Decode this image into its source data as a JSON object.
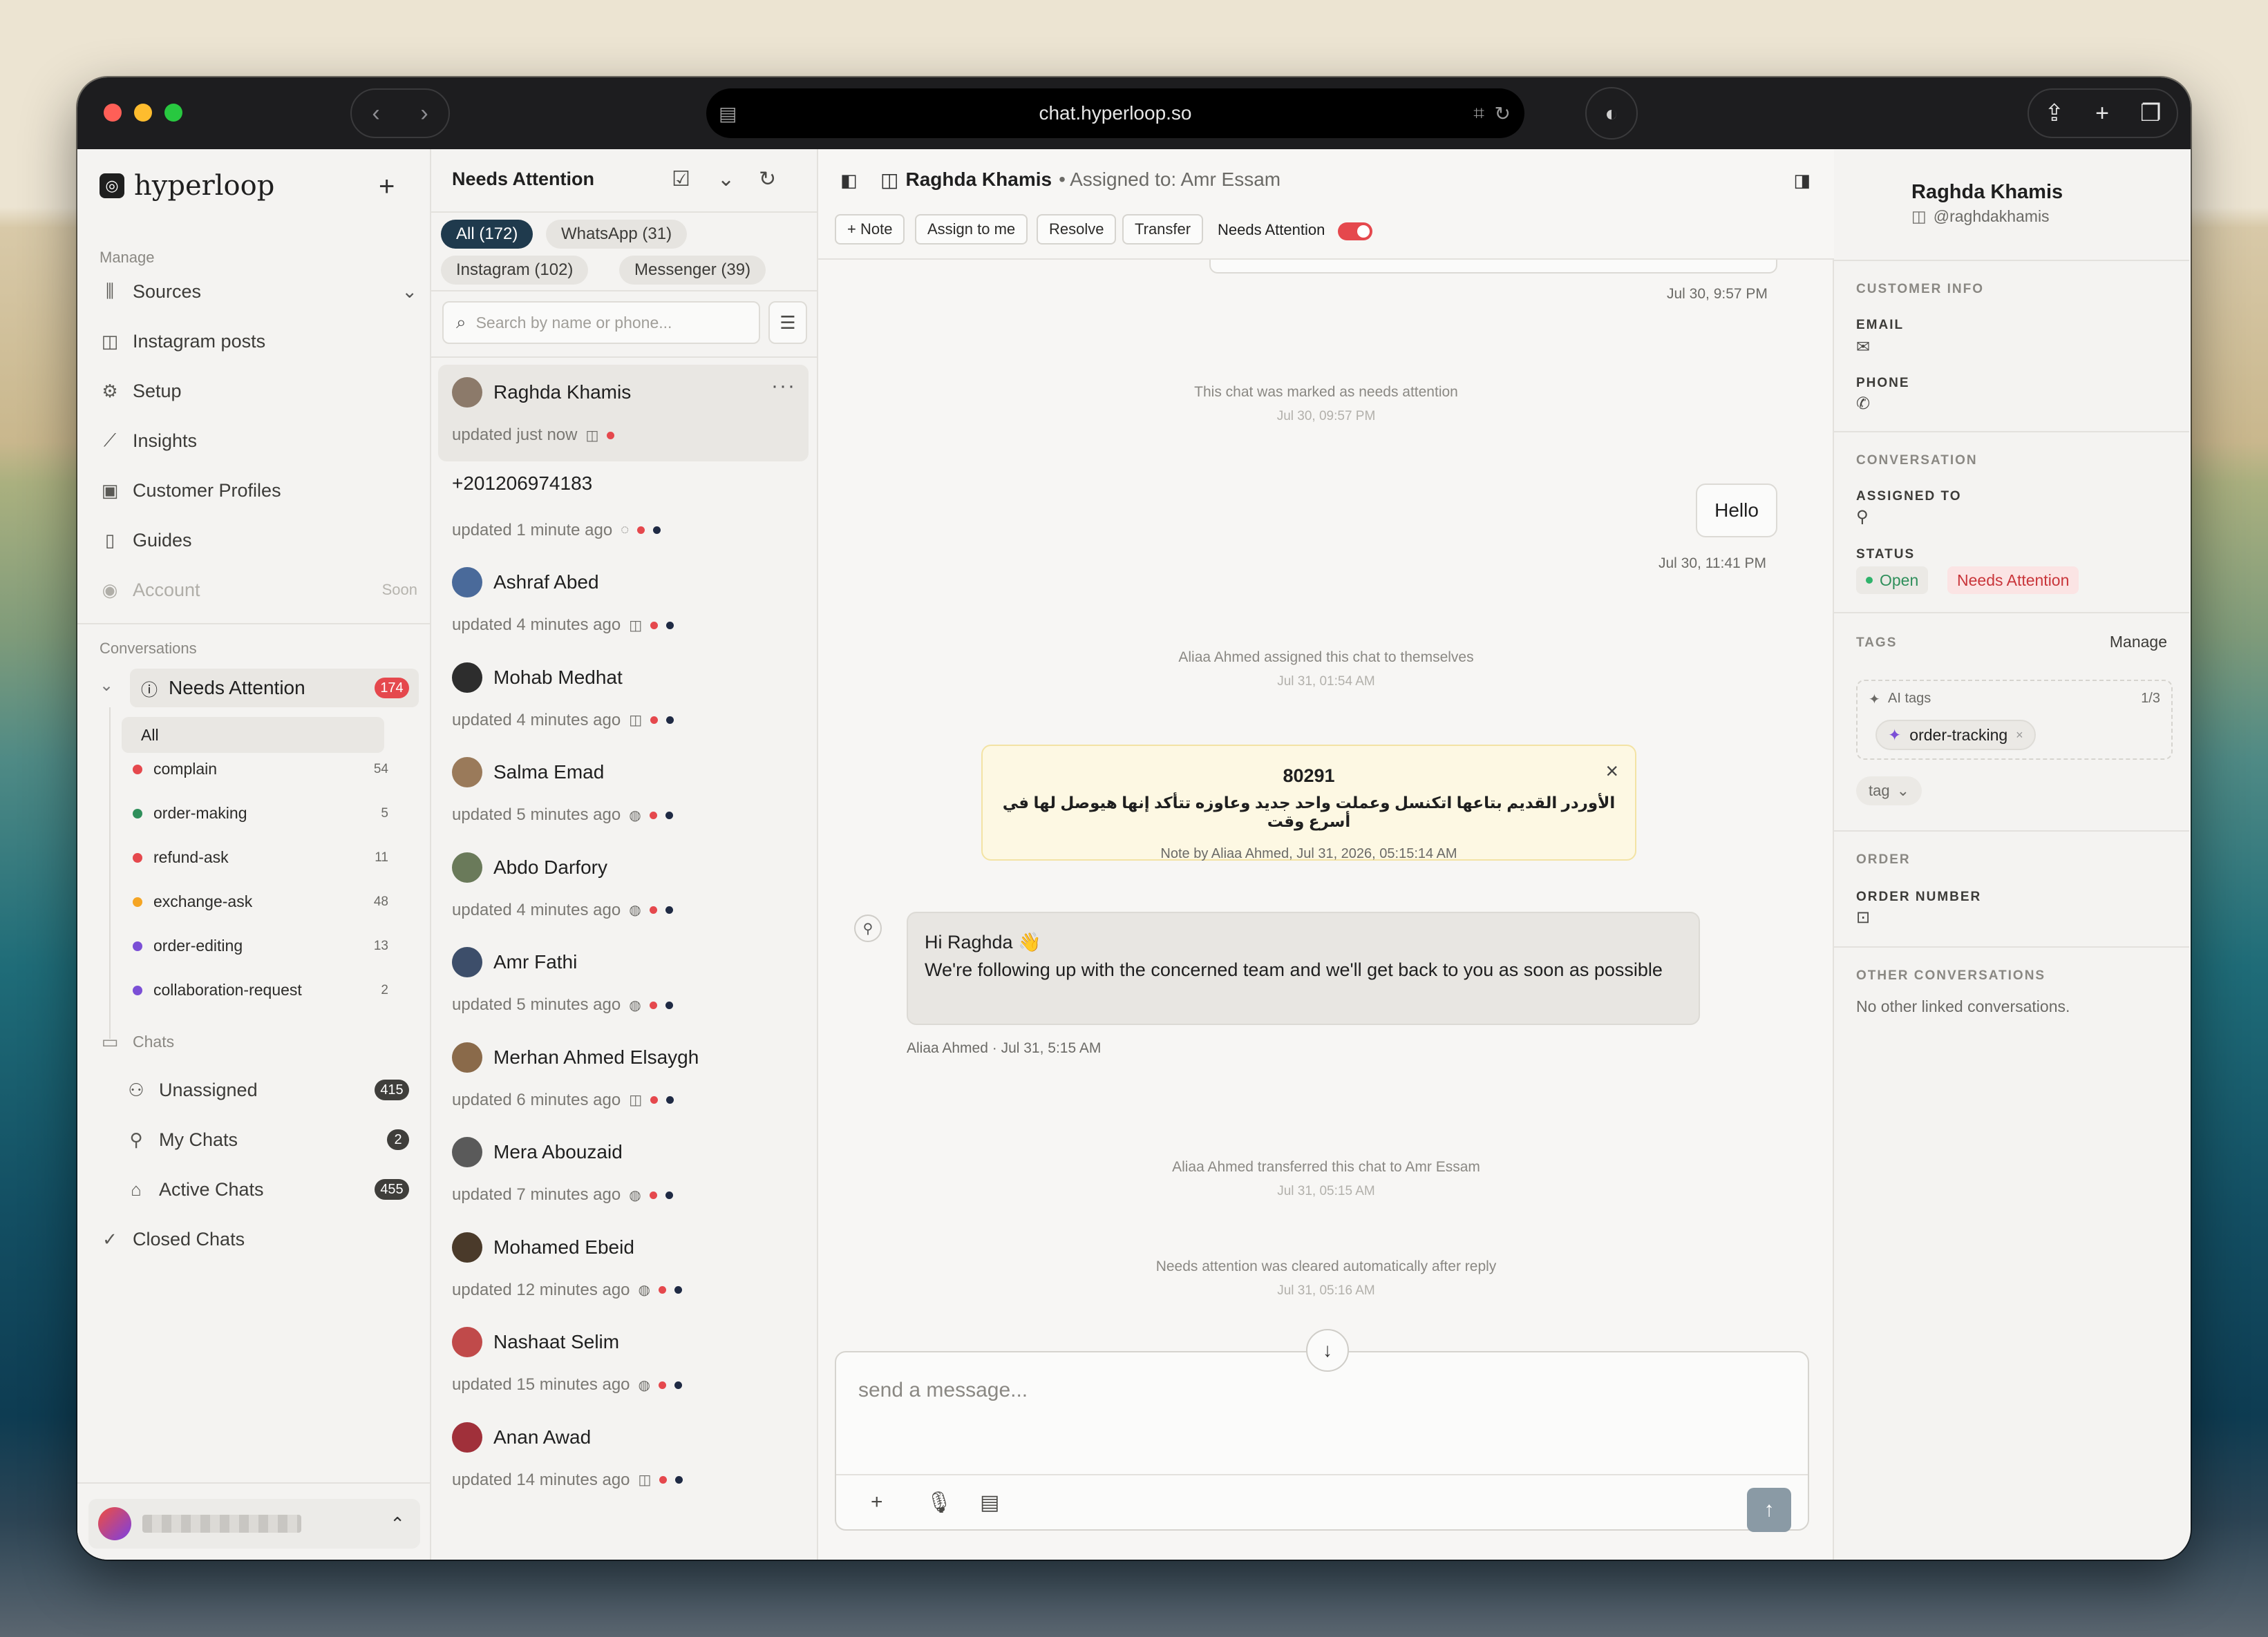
{
  "browser": {
    "url": "chat.hyperloop.so",
    "back_icon": "chevron-left-icon",
    "forward_icon": "chevron-right-icon",
    "colors": {
      "close": "#ff5f57",
      "minimize": "#febc2e",
      "maximize": "#28c840"
    }
  },
  "sidebar": {
    "brand": "hyperloop",
    "manage_label": "Manage",
    "manage_items": [
      {
        "label": "Sources",
        "icon": "library-icon"
      },
      {
        "label": "Instagram posts",
        "icon": "instagram-icon"
      },
      {
        "label": "Setup",
        "icon": "gear-icon"
      },
      {
        "label": "Insights",
        "icon": "chart-icon"
      },
      {
        "label": "Customer Profiles",
        "icon": "contact-icon"
      },
      {
        "label": "Guides",
        "icon": "book-icon"
      },
      {
        "label": "Account",
        "icon": "user-circle-icon",
        "badge": "Soon"
      }
    ],
    "conversations_label": "Conversations",
    "needs_attention": {
      "label": "Needs Attention",
      "count": "174"
    },
    "all_label": "All",
    "tags": [
      {
        "label": "complain",
        "count": "54",
        "color": "#e5484d"
      },
      {
        "label": "order-making",
        "count": "5",
        "color": "#2f8f5b"
      },
      {
        "label": "refund-ask",
        "count": "11",
        "color": "#e5484d"
      },
      {
        "label": "exchange-ask",
        "count": "48",
        "color": "#f5a524"
      },
      {
        "label": "order-editing",
        "count": "13",
        "color": "#7b4fd6"
      },
      {
        "label": "collaboration-request",
        "count": "2",
        "color": "#7b4fd6"
      }
    ],
    "chats_label": "Chats",
    "chats": [
      {
        "label": "Unassigned",
        "count": "415"
      },
      {
        "label": "My Chats",
        "count": "2"
      },
      {
        "label": "Active Chats",
        "count": "455"
      }
    ],
    "closed_label": "Closed Chats"
  },
  "list": {
    "title": "Needs Attention",
    "filters": [
      {
        "label": "All (172)",
        "active": true
      },
      {
        "label": "WhatsApp (31)"
      },
      {
        "label": "Instagram (102)"
      },
      {
        "label": "Messenger (39)"
      }
    ],
    "search_placeholder": "Search by name or phone...",
    "conversations": [
      {
        "name": "Raghda Khamis",
        "updated": "updated just now",
        "channel": "instagram",
        "selected": true
      },
      {
        "name": "+201206974183",
        "updated": "updated 1 minute ago",
        "channel": "whatsapp"
      },
      {
        "name": "Ashraf Abed",
        "updated": "updated 4 minutes ago",
        "channel": "instagram"
      },
      {
        "name": "Mohab Medhat",
        "updated": "updated 4 minutes ago",
        "channel": "instagram"
      },
      {
        "name": "Salma Emad",
        "updated": "updated 5 minutes ago",
        "channel": "messenger"
      },
      {
        "name": "Abdo Darfory",
        "updated": "updated 4 minutes ago",
        "channel": "messenger"
      },
      {
        "name": "Amr Fathi",
        "updated": "updated 5 minutes ago",
        "channel": "messenger"
      },
      {
        "name": "Merhan Ahmed Elsaygh",
        "updated": "updated 6 minutes ago",
        "channel": "instagram"
      },
      {
        "name": "Mera Abouzaid",
        "updated": "updated 7 minutes ago",
        "channel": "messenger"
      },
      {
        "name": "Mohamed Ebeid",
        "updated": "updated 12 minutes ago",
        "channel": "messenger"
      },
      {
        "name": "Nashaat Selim",
        "updated": "updated 15 minutes ago",
        "channel": "messenger"
      },
      {
        "name": "Anan Awad",
        "updated": "updated 14 minutes ago",
        "channel": "instagram"
      }
    ]
  },
  "chat": {
    "contact": "Raghda Khamis",
    "assigned": "• Assigned to: Amr Essam",
    "actions": {
      "note": "+ Note",
      "assign": "Assign to me",
      "resolve": "Resolve",
      "transfer": "Transfer",
      "needs_attention": "Needs Attention"
    },
    "top_time": "Jul 30, 9:57 PM",
    "events": [
      {
        "text": "This chat was marked as needs attention",
        "time": "Jul 30, 09:57 PM"
      },
      {
        "text": "Aliaa Ahmed assigned this chat to themselves",
        "time": "Jul 31, 01:54 AM"
      },
      {
        "text": "Aliaa Ahmed transferred this chat to Amr Essam",
        "time": "Jul 31, 05:15 AM"
      },
      {
        "text": "Needs attention was cleared automatically after reply",
        "time": "Jul 31, 05:16 AM"
      }
    ],
    "outgoing": {
      "text": "Hello",
      "time": "Jul 30, 11:41 PM"
    },
    "note": {
      "number": "80291",
      "text": "الأوردر القديم بتاعها اتكنسل وعملت واحد جديد وعاوزه تتأكد إنها هيوصل لها في أسرع وقت",
      "by": "Note by Aliaa Ahmed, Jul 31, 2026, 05:15:14 AM"
    },
    "incoming": {
      "line1": "Hi Raghda 👋",
      "line2": "We're following up with the concerned team and we'll get back to you as soon as possible",
      "meta": "Aliaa Ahmed · Jul 31, 5:15 AM"
    },
    "composer_placeholder": "send a message..."
  },
  "profile": {
    "name": "Raghda Khamis",
    "handle": "@raghdakhamis",
    "customer_info": "CUSTOMER INFO",
    "email_label": "EMAIL",
    "phone_label": "PHONE",
    "conversation": "CONVERSATION",
    "assigned_label": "ASSIGNED TO",
    "status_label": "STATUS",
    "status_open": "Open",
    "status_attention": "Needs Attention",
    "tags_label": "TAGS",
    "manage": "Manage",
    "ai_tags": "AI tags",
    "ai_count": "1/3",
    "ai_tag": "order-tracking",
    "tag_select": "tag",
    "order": "ORDER",
    "order_number": "ORDER NUMBER",
    "other": "OTHER CONVERSATIONS",
    "other_text": "No other linked conversations."
  }
}
